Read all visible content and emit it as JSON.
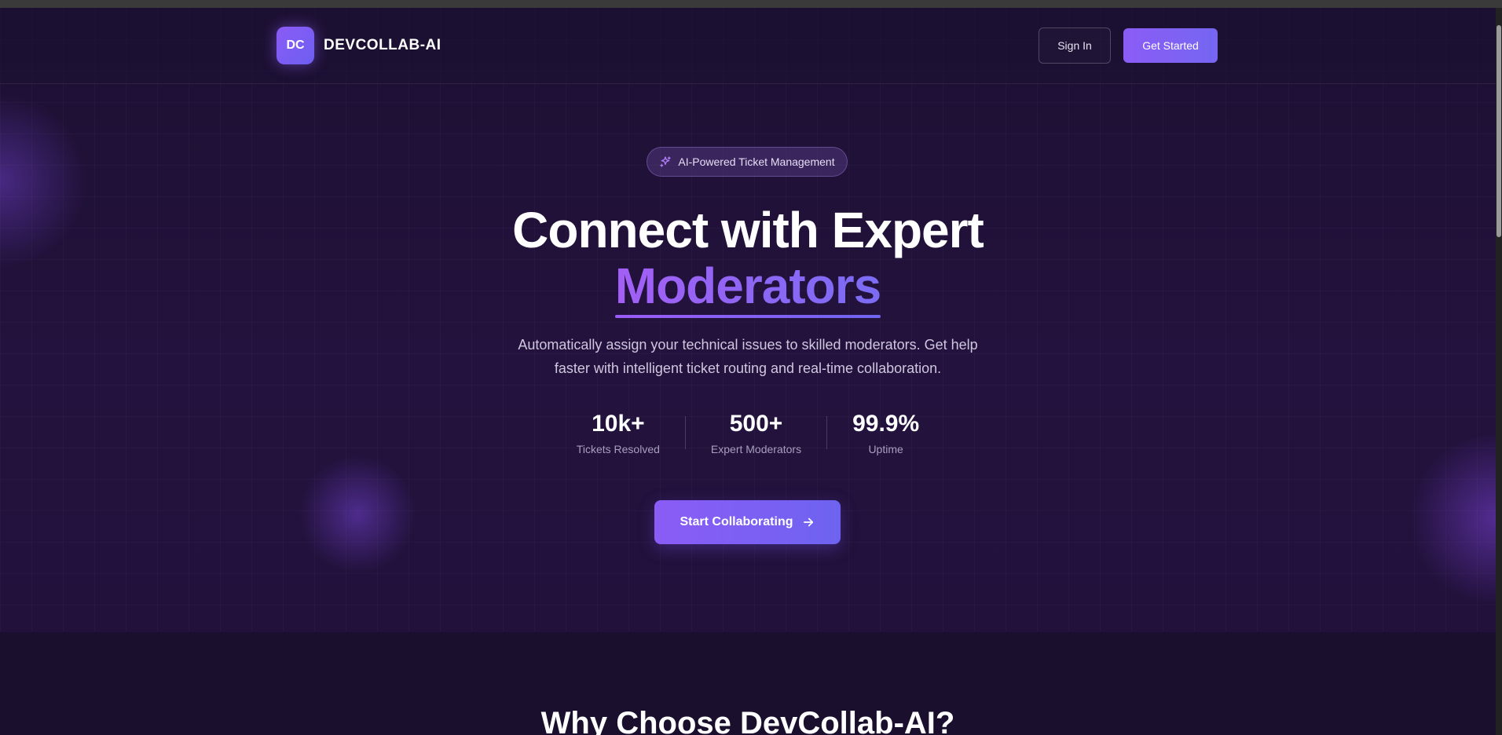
{
  "nav": {
    "logo_initials": "DC",
    "brand_name": "DEVCOLLAB-AI",
    "sign_in_label": "Sign In",
    "get_started_label": "Get Started"
  },
  "hero": {
    "badge_icon": "sparkles-icon",
    "badge_text": "AI-Powered Ticket Management",
    "title_line1": "Connect with Expert",
    "title_line2": "Moderators",
    "subtitle": "Automatically assign your technical issues to skilled moderators. Get help faster with intelligent ticket routing and real-time collaboration.",
    "stats": [
      {
        "value": "10k+",
        "label": "Tickets Resolved"
      },
      {
        "value": "500+",
        "label": "Expert Moderators"
      },
      {
        "value": "99.9%",
        "label": "Uptime"
      }
    ],
    "cta_label": "Start Collaborating",
    "cta_icon": "arrow-right-icon"
  },
  "features": {
    "title": "Why Choose DevCollab-AI?"
  },
  "colors": {
    "accent": "#8b5cf6",
    "accent_secondary": "#6e63f0",
    "background": "#1d1033"
  }
}
